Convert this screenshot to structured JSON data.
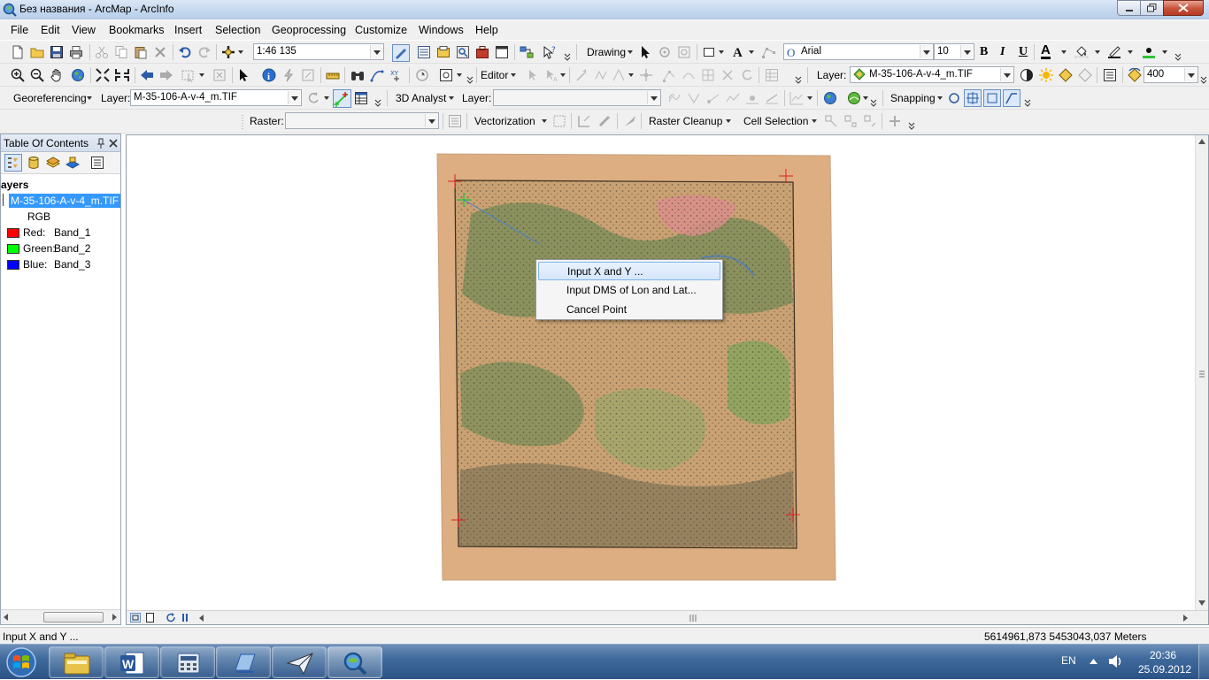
{
  "window": {
    "title": "Без названия - ArcMap - ArcInfo"
  },
  "menu": [
    "File",
    "Edit",
    "View",
    "Bookmarks",
    "Insert",
    "Selection",
    "Geoprocessing",
    "Customize",
    "Windows",
    "Help"
  ],
  "standard_toolbar": {
    "scale": "1:46 135"
  },
  "draw_toolbar": {
    "drawing_label": "Drawing",
    "font_name": "Arial",
    "font_size": "10",
    "bold": "B",
    "italic": "I",
    "underline": "U",
    "font_color_label": "A"
  },
  "tools_toolbar": {
    "editor_label": "Editor",
    "layer_label": "Layer:",
    "layer_value": "M-35-106-A-v-4_m.TIF",
    "transparency_value": "400"
  },
  "georef_toolbar": {
    "georef_label": "Georeferencing",
    "layer_label": "Layer:",
    "layer_value": "M-35-106-A-v-4_m.TIF",
    "analyst_label": "3D Analyst",
    "analyst_layer_label": "Layer:",
    "snapping_label": "Snapping"
  },
  "raster_toolbar": {
    "raster_label": "Raster:",
    "vectorization_label": "Vectorization",
    "cleanup_label": "Raster Cleanup",
    "cell_selection_label": "Cell Selection"
  },
  "toc": {
    "title": "Table Of Contents",
    "pin": "ᵻ",
    "layers_heading": "ayers",
    "layer_name": "M-35-106-A-v-4_m.TIF",
    "renderer": "RGB",
    "bands": [
      {
        "label": "Red:",
        "band": "Band_1",
        "color": "#ff0000"
      },
      {
        "label": "Green:",
        "band": "Band_2",
        "color": "#00ff00"
      },
      {
        "label": "Blue:",
        "band": "Band_3",
        "color": "#0000ff"
      }
    ]
  },
  "context_menu": {
    "items": [
      {
        "label": "Input X and Y ...",
        "highlighted": true
      },
      {
        "label": "Input DMS of Lon and Lat...",
        "highlighted": false
      },
      {
        "label": "Cancel Point",
        "highlighted": false
      }
    ]
  },
  "status_bar": {
    "message": "Input X and Y ...",
    "coordinates": "5614961,873  5453043,037 Meters"
  },
  "taskbar": {
    "language": "EN",
    "time": "20:36",
    "date": "25.09.2012"
  },
  "colors": {
    "title_bar": "#c3d7ee",
    "highlight": "#3399ff",
    "taskbar": "#3f6a9c",
    "map_paper": "#d9a87a"
  }
}
